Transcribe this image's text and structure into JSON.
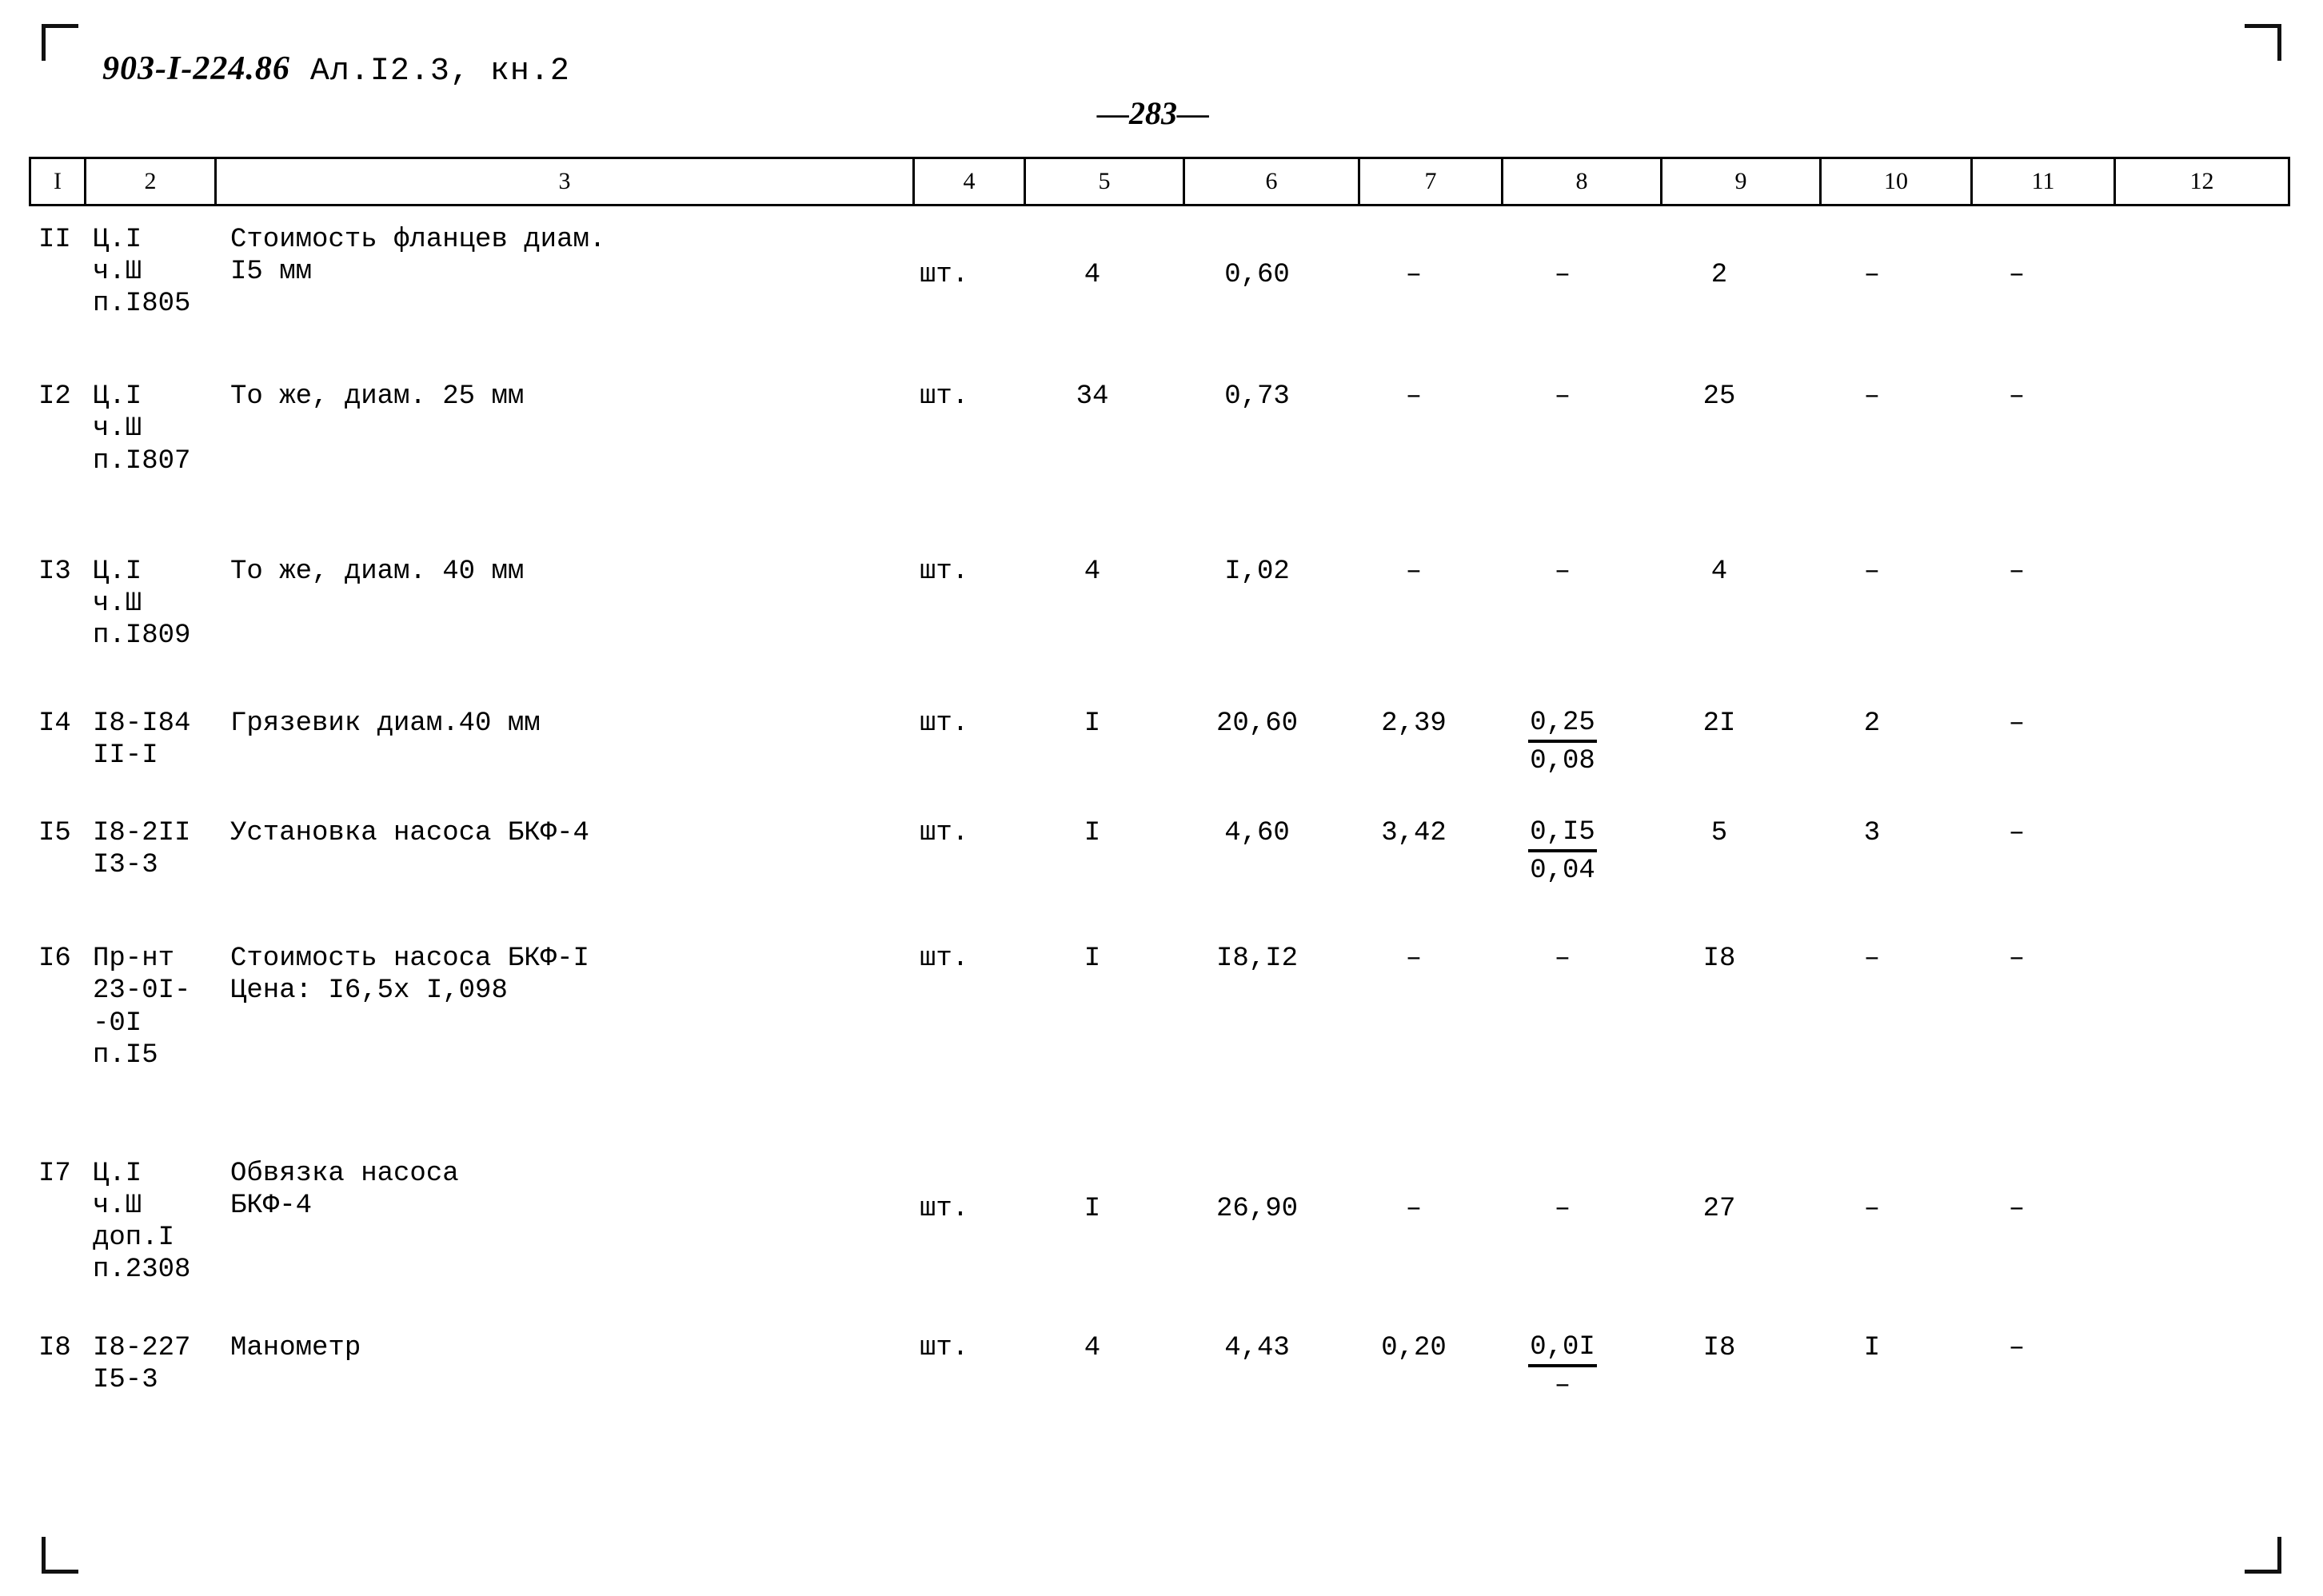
{
  "header": {
    "document_code": "903-I-224.86",
    "album": "Ал.I2.3, кн.2",
    "page_number": "—283—"
  },
  "table": {
    "column_headers": [
      "I",
      "2",
      "3",
      "4",
      "5",
      "6",
      "7",
      "8",
      "9",
      "10",
      "11",
      "12"
    ],
    "rows": [
      {
        "n": "II",
        "ref": "Ц.I\nч.Ш\nп.I805",
        "description": "Стоимость фланцев диам.\nI5 мм",
        "unit": "шт.",
        "qty": "4",
        "c6": "0,60",
        "c7": "–",
        "c8_top": "–",
        "c8_bot": "",
        "c9": "2",
        "c10": "–",
        "c11": "–",
        "c12": ""
      },
      {
        "n": "I2",
        "ref": "Ц.I\nч.Ш\nп.I807",
        "description": "То же, диам. 25 мм",
        "unit": "шт.",
        "qty": "34",
        "c6": "0,73",
        "c7": "–",
        "c8_top": "–",
        "c8_bot": "",
        "c9": "25",
        "c10": "–",
        "c11": "–",
        "c12": ""
      },
      {
        "n": "I3",
        "ref": "Ц.I\nч.Ш\nп.I809",
        "description": "То же, диам. 40 мм",
        "unit": "шт.",
        "qty": "4",
        "c6": "I,02",
        "c7": "–",
        "c8_top": "–",
        "c8_bot": "",
        "c9": "4",
        "c10": "–",
        "c11": "–",
        "c12": ""
      },
      {
        "n": "I4",
        "ref": "I8-I84\nII-I",
        "description": "Грязевик диам.40 мм",
        "unit": "шт.",
        "qty": "I",
        "c6": "20,60",
        "c7": "2,39",
        "c8_top": "0,25",
        "c8_bot": "0,08",
        "c9": "2I",
        "c10": "2",
        "c11": "–",
        "c12": ""
      },
      {
        "n": "I5",
        "ref": "I8-2II\nI3-3",
        "description": "Установка насоса БКФ-4",
        "unit": "шт.",
        "qty": "I",
        "c6": "4,60",
        "c7": "3,42",
        "c8_top": "0,I5",
        "c8_bot": "0,04",
        "c9": "5",
        "c10": "3",
        "c11": "–",
        "c12": ""
      },
      {
        "n": "I6",
        "ref": "Пр-нт\n23-0I-\n-0I\nп.I5",
        "description": "Стоимость насоса БКФ-I\nЦена: I6,5х I,098",
        "unit": "шт.",
        "qty": "I",
        "c6": "I8,I2",
        "c7": "–",
        "c8_top": "–",
        "c8_bot": "",
        "c9": "I8",
        "c10": "–",
        "c11": "–",
        "c12": ""
      },
      {
        "n": "I7",
        "ref": "Ц.I\nч.Ш\nдоп.I\nп.2308",
        "description": "Обвязка насоса\n   БКФ-4",
        "unit": "шт.",
        "qty": "I",
        "c6": "26,90",
        "c7": "–",
        "c8_top": "–",
        "c8_bot": "",
        "c9": "27",
        "c10": "–",
        "c11": "–",
        "c12": ""
      },
      {
        "n": "I8",
        "ref": "I8-227\nI5-3",
        "description": "Манометр",
        "unit": "шт.",
        "qty": "4",
        "c6": "4,43",
        "c7": "0,20",
        "c8_top": "0,0I",
        "c8_bot": "–",
        "c9": "I8",
        "c10": "I",
        "c11": "–",
        "c12": ""
      }
    ]
  }
}
